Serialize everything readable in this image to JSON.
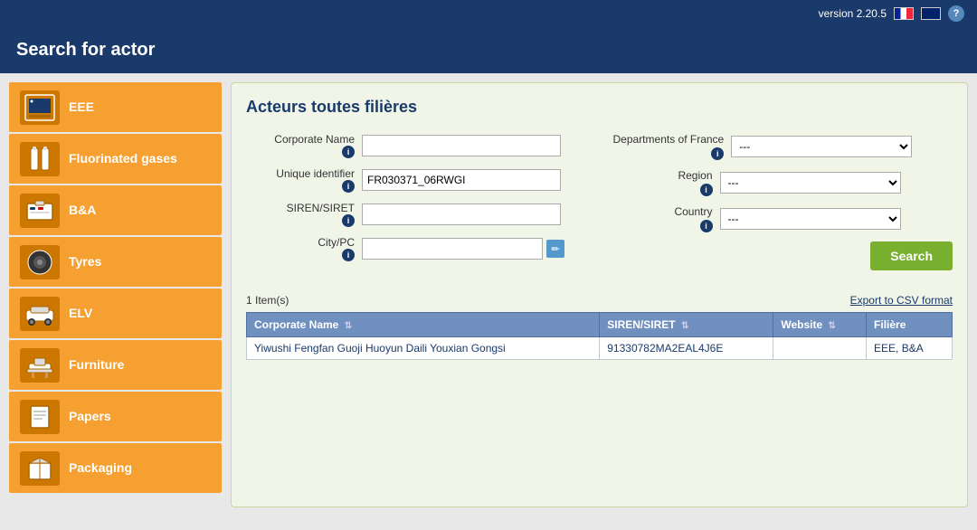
{
  "app": {
    "version": "version 2.20.5",
    "title": "Search for actor"
  },
  "topbar": {
    "version_label": "version 2.20.5",
    "help_label": "?"
  },
  "sidebar": {
    "items": [
      {
        "id": "eee",
        "label": "EEE",
        "icon": "icon-eee"
      },
      {
        "id": "fluorinated",
        "label": "Fluorinated gases",
        "icon": "icon-fluorinated"
      },
      {
        "id": "ba",
        "label": "B&A",
        "icon": "icon-ba"
      },
      {
        "id": "tyres",
        "label": "Tyres",
        "icon": "icon-tyres"
      },
      {
        "id": "elv",
        "label": "ELV",
        "icon": "icon-elv"
      },
      {
        "id": "furniture",
        "label": "Furniture",
        "icon": "icon-furniture"
      },
      {
        "id": "papers",
        "label": "Papers",
        "icon": "icon-papers"
      },
      {
        "id": "packaging",
        "label": "Packaging",
        "icon": "icon-packaging"
      }
    ]
  },
  "content": {
    "section_title": "Acteurs toutes filières",
    "form": {
      "corporate_name_label": "Corporate Name",
      "unique_id_label": "Unique identifier",
      "unique_id_value": "FR030371_06RWGI",
      "siren_label": "SIREN/SIRET",
      "city_label": "City/PC",
      "departments_label": "Departments of France",
      "departments_default": "---",
      "region_label": "Region",
      "region_default": "---",
      "country_label": "Country",
      "country_default": "---",
      "search_button": "Search",
      "export_link": "Export to CSV format"
    },
    "results": {
      "count_text": "1 Item(s)",
      "columns": [
        {
          "key": "corporate_name",
          "label": "Corporate Name"
        },
        {
          "key": "siren_siret",
          "label": "SIREN/SIRET"
        },
        {
          "key": "website",
          "label": "Website"
        },
        {
          "key": "filiere",
          "label": "Filière"
        }
      ],
      "rows": [
        {
          "corporate_name": "Yiwushi Fengfan Guoji Huoyun Daili Youxian Gongsi",
          "siren_siret": "91330782MA2EAL4J6E",
          "website": "",
          "filiere": "EEE, B&A"
        }
      ]
    }
  }
}
